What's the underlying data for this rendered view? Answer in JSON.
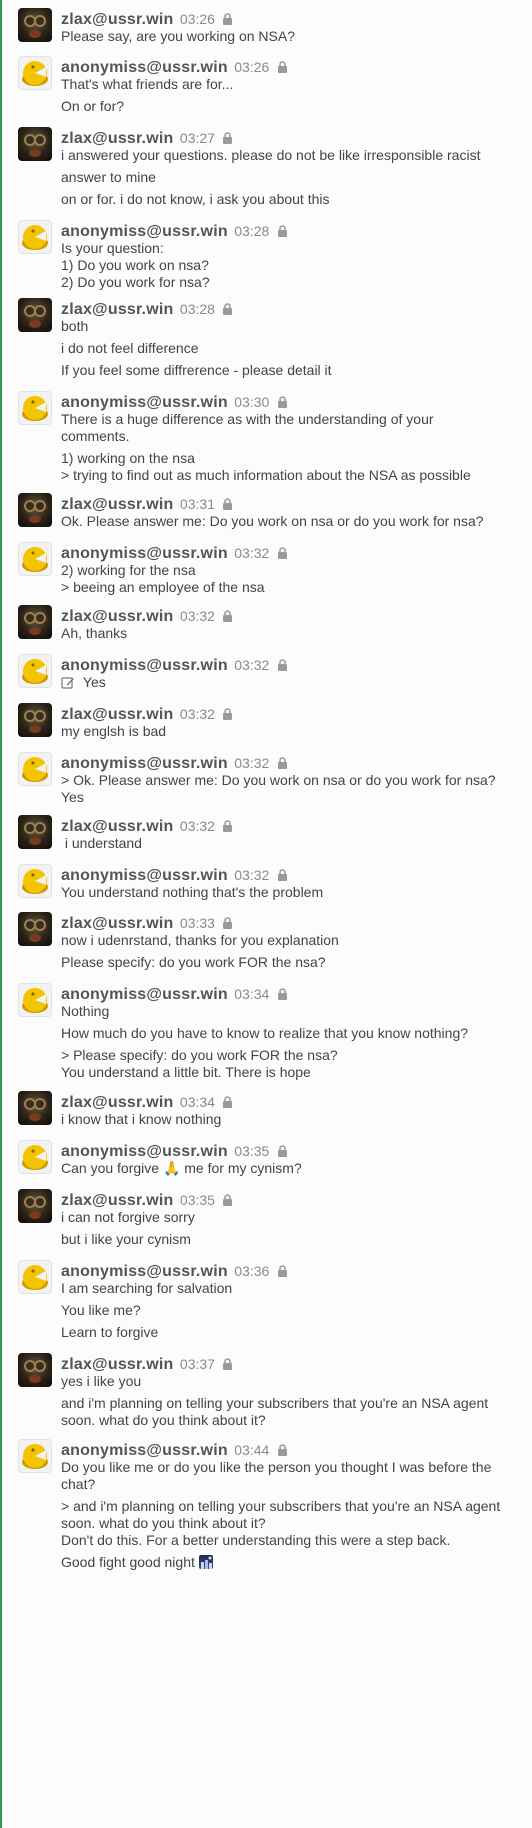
{
  "users": {
    "zlax": {
      "name": "zlax@ussr.win"
    },
    "anon": {
      "name": "anonymiss@ussr.win"
    }
  },
  "messages": [
    {
      "user": "zlax",
      "time": "03:26",
      "lines": [
        "Please say, are you working on NSA?"
      ]
    },
    {
      "user": "anon",
      "time": "03:26",
      "lines": [
        "That's what friends are for...",
        "On or for?"
      ]
    },
    {
      "user": "zlax",
      "time": "03:27",
      "lines": [
        "i answered your questions. please do not be like irresponsible racist",
        "answer to mine",
        "on or for. i do not know, i ask you about this"
      ]
    },
    {
      "user": "anon",
      "time": "03:28",
      "lines": [
        "Is your question:",
        "1) Do you work on nsa?",
        "2) Do you work for nsa?"
      ]
    },
    {
      "user": "zlax",
      "time": "03:28",
      "lines": [
        "both",
        "i do not feel difference",
        "If you feel some diffrerence - please detail it"
      ]
    },
    {
      "user": "anon",
      "time": "03:30",
      "lines": [
        "There is a huge difference as with the understanding of your",
        "comments.",
        "1) working on the nsa",
        "> trying to find out as much information about the NSA as possible"
      ]
    },
    {
      "user": "zlax",
      "time": "03:31",
      "lines": [
        "Ok. Please answer me: Do you work on nsa or do you work for nsa?"
      ]
    },
    {
      "user": "anon",
      "time": "03:32",
      "lines": [
        "2) working for the nsa",
        "> beeing an employee of the nsa"
      ]
    },
    {
      "user": "zlax",
      "time": "03:32",
      "lines": [
        "Ah, thanks"
      ]
    },
    {
      "user": "anon",
      "time": "03:32",
      "lines": [
        "Yes"
      ]
    },
    {
      "user": "zlax",
      "time": "03:32",
      "lines": [
        "my englsh is bad"
      ]
    },
    {
      "user": "anon",
      "time": "03:32",
      "lines": [
        "> Ok. Please answer me: Do you work on nsa or do you work for nsa?",
        "Yes"
      ]
    },
    {
      "user": "zlax",
      "time": "03:32",
      "lines": [
        " i understand"
      ]
    },
    {
      "user": "anon",
      "time": "03:32",
      "lines": [
        "You understand nothing that's the problem"
      ]
    },
    {
      "user": "zlax",
      "time": "03:33",
      "lines": [
        "now i udenrstand, thanks for you explanation",
        "Please specify: do you work FOR the nsa?"
      ]
    },
    {
      "user": "anon",
      "time": "03:34",
      "lines": [
        "Nothing",
        "How much do you have to know to realize that you know nothing?",
        "> Please specify: do you work FOR the nsa?",
        "You understand a little bit. There is hope"
      ]
    },
    {
      "user": "zlax",
      "time": "03:34",
      "lines": [
        "i know that i know nothing"
      ]
    },
    {
      "user": "anon",
      "time": "03:35",
      "lines": [
        "Can you forgive 🙏 me for my cynism?"
      ]
    },
    {
      "user": "zlax",
      "time": "03:35",
      "lines": [
        "i can not forgive sorry",
        "but i like your cynism"
      ]
    },
    {
      "user": "anon",
      "time": "03:36",
      "lines": [
        "I am searching for salvation",
        "You like me?",
        "Learn to forgive"
      ]
    },
    {
      "user": "zlax",
      "time": "03:37",
      "lines": [
        "yes i like you",
        "and i'm planning on telling your subscribers that you're an NSA agent",
        "soon. what do you think about it?"
      ]
    },
    {
      "user": "anon",
      "time": "03:44",
      "lines": [
        "Do you like me or do you like the person you thought I was before the",
        "chat?",
        "> and i'm planning on telling your subscribers that you're an NSA agent",
        "soon. what do you think about it?",
        "Don't do this. For a better understanding this were a step back.",
        "Good fight good night"
      ]
    }
  ],
  "icons": {
    "lock": "lock-icon",
    "edit": "edit-icon",
    "night": "night-city-icon"
  },
  "colors": {
    "border": "#2f9a4a",
    "author": "#555555",
    "time": "#8a8a8a",
    "text": "#444444"
  }
}
